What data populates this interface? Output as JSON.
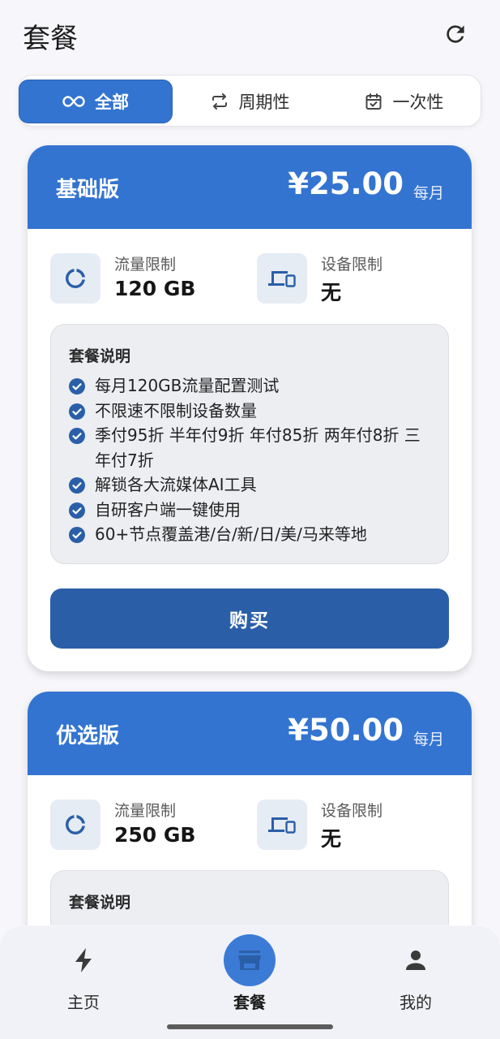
{
  "header": {
    "title": "套餐"
  },
  "filters": [
    {
      "label": "全部",
      "icon": "infinity-icon",
      "active": true
    },
    {
      "label": "周期性",
      "icon": "repeat-icon",
      "active": false
    },
    {
      "label": "一次性",
      "icon": "calendar-check-icon",
      "active": false
    }
  ],
  "plans": [
    {
      "name": "基础版",
      "price": "¥25.00",
      "period": "每月",
      "traffic_label": "流量限制",
      "traffic_value": "120 GB",
      "device_label": "设备限制",
      "device_value": "无",
      "desc_title": "套餐说明",
      "features": [
        "每月120GB流量配置测试",
        "不限速不限制设备数量",
        "季付95折 半年付9折 年付85折 两年付8折 三年付7折",
        "解锁各大流媒体AI工具",
        "自研客户端一键使用",
        "60+节点覆盖港/台/新/日/美/马来等地"
      ],
      "buy_label": "购买"
    },
    {
      "name": "优选版",
      "price": "¥50.00",
      "period": "每月",
      "traffic_label": "流量限制",
      "traffic_value": "250 GB",
      "device_label": "设备限制",
      "device_value": "无",
      "desc_title": "套餐说明"
    }
  ],
  "nav": [
    {
      "label": "主页",
      "icon": "bolt-icon",
      "active": false
    },
    {
      "label": "套餐",
      "icon": "store-icon",
      "active": true
    },
    {
      "label": "我的",
      "icon": "person-icon",
      "active": false
    }
  ],
  "colors": {
    "primary": "#3374d1",
    "button": "#2a5fa8",
    "background": "#f7f7fb"
  }
}
